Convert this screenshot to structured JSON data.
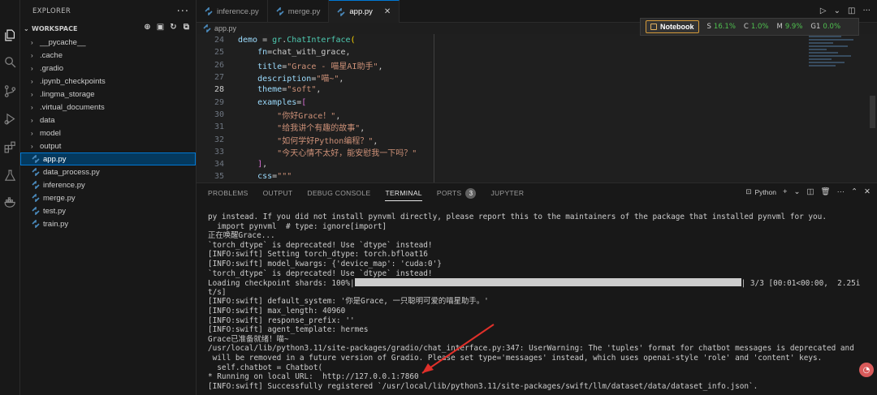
{
  "activity_bar": {
    "icons": [
      "explorer-icon",
      "search-icon",
      "source-control-icon",
      "run-debug-icon",
      "extensions-icon",
      "testing-icon",
      "docker-icon"
    ]
  },
  "sidebar": {
    "title": "EXPLORER",
    "more": "···",
    "workspace": "WORKSPACE",
    "items": [
      {
        "label": "__pycache__",
        "type": "folder"
      },
      {
        "label": ".cache",
        "type": "folder"
      },
      {
        "label": ".gradio",
        "type": "folder"
      },
      {
        "label": ".ipynb_checkpoints",
        "type": "folder"
      },
      {
        "label": ".lingma_storage",
        "type": "folder"
      },
      {
        "label": ".virtual_documents",
        "type": "folder"
      },
      {
        "label": "data",
        "type": "folder"
      },
      {
        "label": "model",
        "type": "folder"
      },
      {
        "label": "output",
        "type": "folder"
      },
      {
        "label": "app.py",
        "type": "file",
        "selected": true
      },
      {
        "label": "data_process.py",
        "type": "file"
      },
      {
        "label": "inference.py",
        "type": "file"
      },
      {
        "label": "merge.py",
        "type": "file"
      },
      {
        "label": "test.py",
        "type": "file"
      },
      {
        "label": "train.py",
        "type": "file"
      }
    ]
  },
  "tabs": [
    {
      "label": "inference.py",
      "active": false
    },
    {
      "label": "merge.py",
      "active": false
    },
    {
      "label": "app.py",
      "active": true
    }
  ],
  "breadcrumb": "app.py",
  "notebook_bar": {
    "button": "Notebook",
    "stats": [
      {
        "label": "S",
        "value": "16.1%"
      },
      {
        "label": "C",
        "value": "1.0%"
      },
      {
        "label": "M",
        "value": "9.9%"
      },
      {
        "label": "G1",
        "value": "0.0%"
      }
    ]
  },
  "code": {
    "lines": [
      {
        "n": "24",
        "text": "demo = gr.ChatInterface("
      },
      {
        "n": "25",
        "text": "    fn=chat_with_grace,"
      },
      {
        "n": "26",
        "text": "    title=\"Grace - 喵星AI助手\","
      },
      {
        "n": "27",
        "text": "    description=\"喵~\","
      },
      {
        "n": "28",
        "text": "    theme=\"soft\","
      },
      {
        "n": "29",
        "text": "    examples=["
      },
      {
        "n": "30",
        "text": "        \"你好Grace！\","
      },
      {
        "n": "31",
        "text": "        \"给我讲个有趣的故事\","
      },
      {
        "n": "32",
        "text": "        \"如何学好Python编程？\","
      },
      {
        "n": "33",
        "text": "        \"今天心情不太好，能安慰我一下吗？\""
      },
      {
        "n": "34",
        "text": "    ],"
      },
      {
        "n": "35",
        "text": "    css=\"\"\""
      }
    ]
  },
  "panel": {
    "tabs": [
      "PROBLEMS",
      "OUTPUT",
      "DEBUG CONSOLE",
      "TERMINAL",
      "PORTS",
      "JUPYTER"
    ],
    "active_tab": "TERMINAL",
    "ports_count": "3",
    "terminal_name": "Python",
    "terminal_lines": [
      "py instead. If you did not install pynvml directly, please report this to the maintainers of the package that installed pynvml for you.",
      "  import pynvml  # type: ignore[import]",
      "正在唤醒Grace...",
      "`torch_dtype` is deprecated! Use `dtype` instead!",
      "[INFO:swift] Setting torch_dtype: torch.bfloat16",
      "[INFO:swift] model_kwargs: {'device_map': 'cuda:0'}",
      "`torch_dtype` is deprecated! Use `dtype` instead!",
      "Loading checkpoint shards: 100%|",
      "t/s]",
      "[INFO:swift] default_system: '你是Grace, 一只聪明可爱的喵星助手。'",
      "[INFO:swift] max_length: 40960",
      "[INFO:swift] response_prefix: ''",
      "[INFO:swift] agent_template: hermes",
      "Grace已准备就绪！喵~",
      "/usr/local/lib/python3.11/site-packages/gradio/chat_interface.py:347: UserWarning: The 'tuples' format for chatbot messages is deprecated and",
      " will be removed in a future version of Gradio. Please set type='messages' instead, which uses openai-style 'role' and 'content' keys.",
      "  self.chatbot = Chatbot(",
      "* Running on local URL:  http://127.0.0.1:7860",
      "[INFO:swift] Successfully registered `/usr/local/lib/python3.11/site-packages/swift/llm/dataset/data/dataset_info.json`."
    ],
    "progress_suffix": "| 3/3 [00:01<00:00,  2.25i",
    "progress_value": 1.0
  },
  "colors": {
    "accent": "#0078d4",
    "annotation_arrow": "#e0302a"
  }
}
